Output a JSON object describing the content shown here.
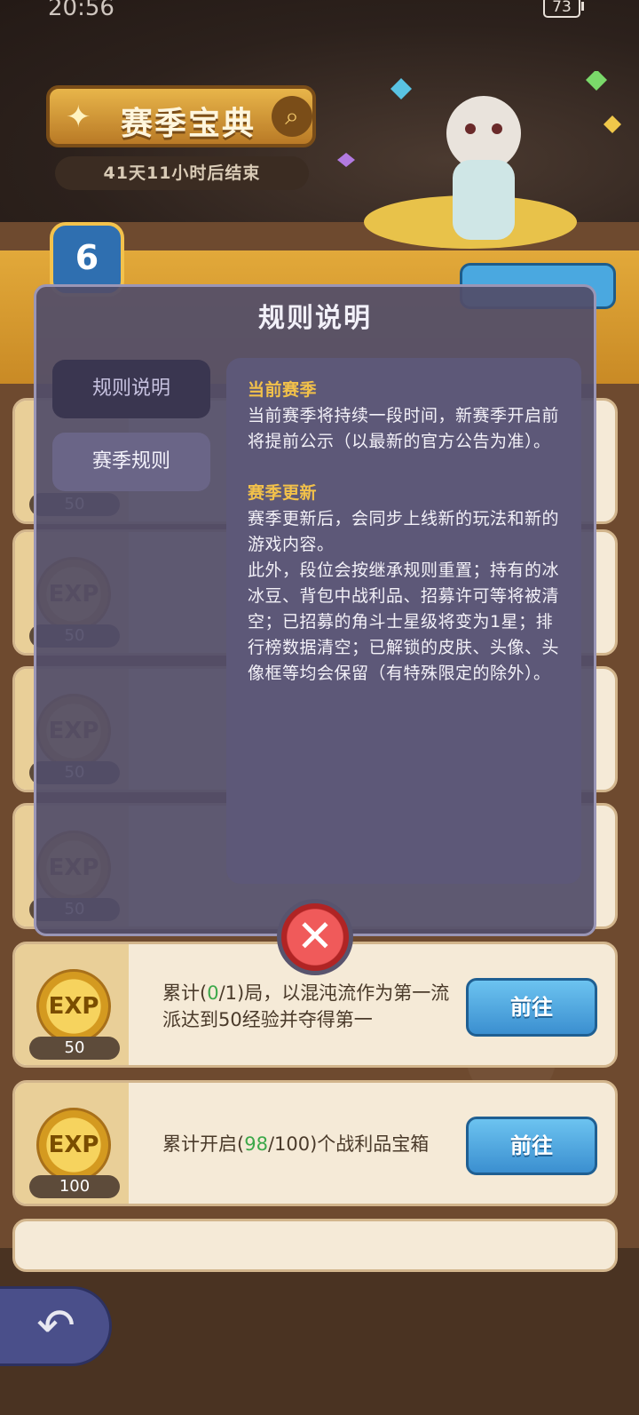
{
  "status_bar": {
    "time": "20:56",
    "battery": "73"
  },
  "header": {
    "title": "赛季宝典",
    "countdown": "41天11小时后结束",
    "level": "6"
  },
  "modal": {
    "title": "规则说明",
    "tabs": [
      {
        "label": "规则说明",
        "selected": false
      },
      {
        "label": "赛季规则",
        "selected": true
      }
    ],
    "sections": [
      {
        "heading": "当前赛季",
        "paragraphs": [
          "当前赛季将持续一段时间，新赛季开启前将提前公示（以最新的官方公告为准）。"
        ]
      },
      {
        "heading": "赛季更新",
        "paragraphs": [
          "赛季更新后，会同步上线新的玩法和新的游戏内容。",
          "此外，段位会按继承规则重置；持有的冰冰豆、背包中战利品、招募许可等将被清空；已招募的角斗士星级将变为1星；排行榜数据清空；已解锁的皮肤、头像、头像框等均会保留（有特殊限定的除外）。"
        ]
      }
    ]
  },
  "tasks": [
    {
      "exp_label": "EXP",
      "exp_amount": "50",
      "desc_prefix": "累计(",
      "progress": "0",
      "desc_mid": "/1)局，以混沌流作为第一流派达到50经验并夺得第一",
      "button": "前往"
    },
    {
      "exp_label": "EXP",
      "exp_amount": "100",
      "desc_prefix": "累计开启(",
      "progress": "98",
      "desc_mid": "/100)个战利品宝箱",
      "button": "前往"
    }
  ],
  "hidden_tasks_exp": [
    "50",
    "50",
    "50",
    "50"
  ]
}
